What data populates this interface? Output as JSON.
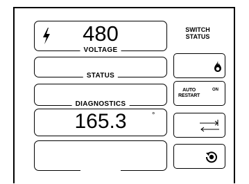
{
  "fields": {
    "voltage": {
      "value": "480",
      "label": "VOLTAGE"
    },
    "status": {
      "value": "",
      "label": "STATUS"
    },
    "diagnostics": {
      "value": "",
      "label": "DIAGNOSTICS"
    },
    "reading": {
      "value": "165.3",
      "unit": "°"
    },
    "bottom": {
      "value": ""
    }
  },
  "switch_status": {
    "title_line1": "SWITCH",
    "title_line2": "STATUS"
  },
  "auto_restart": {
    "line1": "AUTO",
    "line2": "RESTART",
    "state": "ON"
  },
  "icons": {
    "voltage": "lightning-bolt-icon",
    "flame": "flame-icon",
    "transfer": "transfer-arrows-icon",
    "refresh": "refresh-icon"
  }
}
